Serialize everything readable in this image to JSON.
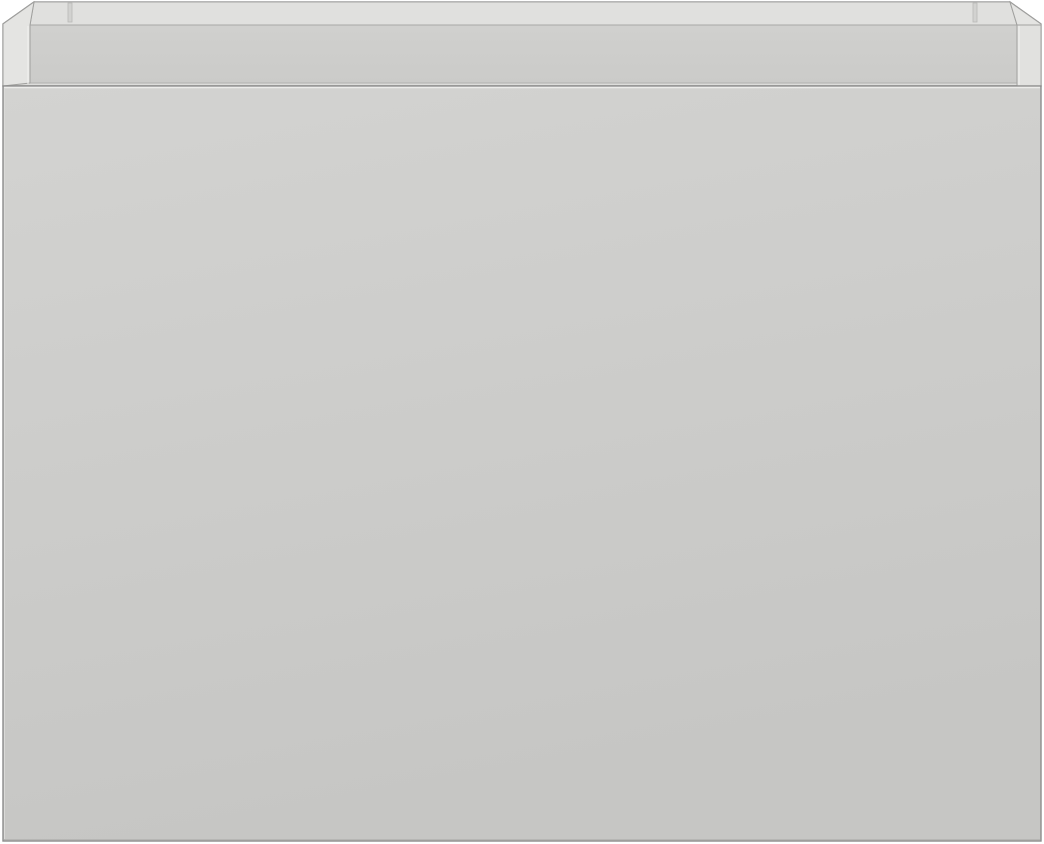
{
  "product": {
    "kind": "wall cabinet with open-top drawer front",
    "has_handle": false
  },
  "colors": {
    "background": "#ffffff",
    "outline": "#8c8c8c",
    "outline_light": "#b4b4b4",
    "front_top": "#d3d3d1",
    "front_bottom": "#c6c6c4",
    "box_inner_back": "#cfcfcd",
    "box_inner_side": "#dcdcda",
    "rim_top": "#e2e2e0",
    "edge_highlight": "#ededeb",
    "edge_shadow": "#b9b9b7"
  }
}
